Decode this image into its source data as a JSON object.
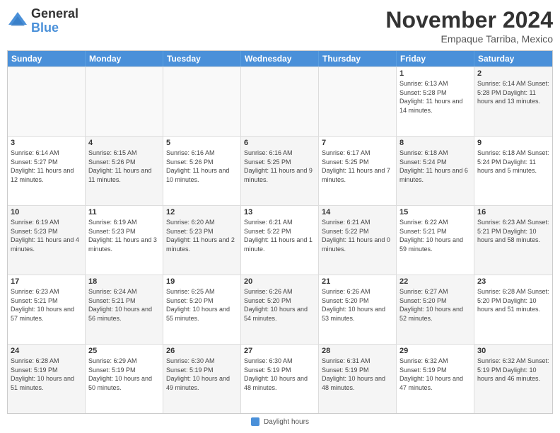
{
  "logo": {
    "general": "General",
    "blue": "Blue"
  },
  "title": "November 2024",
  "location": "Empaque Tarriba, Mexico",
  "headers": [
    "Sunday",
    "Monday",
    "Tuesday",
    "Wednesday",
    "Thursday",
    "Friday",
    "Saturday"
  ],
  "footer_label": "Daylight hours",
  "rows": [
    [
      {
        "day": "",
        "info": "",
        "empty": true
      },
      {
        "day": "",
        "info": "",
        "empty": true
      },
      {
        "day": "",
        "info": "",
        "empty": true
      },
      {
        "day": "",
        "info": "",
        "empty": true
      },
      {
        "day": "",
        "info": "",
        "empty": true
      },
      {
        "day": "1",
        "info": "Sunrise: 6:13 AM\nSunset: 5:28 PM\nDaylight: 11 hours\nand 14 minutes.",
        "empty": false
      },
      {
        "day": "2",
        "info": "Sunrise: 6:14 AM\nSunset: 5:28 PM\nDaylight: 11 hours\nand 13 minutes.",
        "empty": false,
        "shaded": true
      }
    ],
    [
      {
        "day": "3",
        "info": "Sunrise: 6:14 AM\nSunset: 5:27 PM\nDaylight: 11 hours\nand 12 minutes.",
        "empty": false
      },
      {
        "day": "4",
        "info": "Sunrise: 6:15 AM\nSunset: 5:26 PM\nDaylight: 11 hours\nand 11 minutes.",
        "empty": false,
        "shaded": true
      },
      {
        "day": "5",
        "info": "Sunrise: 6:16 AM\nSunset: 5:26 PM\nDaylight: 11 hours\nand 10 minutes.",
        "empty": false
      },
      {
        "day": "6",
        "info": "Sunrise: 6:16 AM\nSunset: 5:25 PM\nDaylight: 11 hours\nand 9 minutes.",
        "empty": false,
        "shaded": true
      },
      {
        "day": "7",
        "info": "Sunrise: 6:17 AM\nSunset: 5:25 PM\nDaylight: 11 hours\nand 7 minutes.",
        "empty": false
      },
      {
        "day": "8",
        "info": "Sunrise: 6:18 AM\nSunset: 5:24 PM\nDaylight: 11 hours\nand 6 minutes.",
        "empty": false,
        "shaded": true
      },
      {
        "day": "9",
        "info": "Sunrise: 6:18 AM\nSunset: 5:24 PM\nDaylight: 11 hours\nand 5 minutes.",
        "empty": false
      }
    ],
    [
      {
        "day": "10",
        "info": "Sunrise: 6:19 AM\nSunset: 5:23 PM\nDaylight: 11 hours\nand 4 minutes.",
        "empty": false,
        "shaded": true
      },
      {
        "day": "11",
        "info": "Sunrise: 6:19 AM\nSunset: 5:23 PM\nDaylight: 11 hours\nand 3 minutes.",
        "empty": false
      },
      {
        "day": "12",
        "info": "Sunrise: 6:20 AM\nSunset: 5:23 PM\nDaylight: 11 hours\nand 2 minutes.",
        "empty": false,
        "shaded": true
      },
      {
        "day": "13",
        "info": "Sunrise: 6:21 AM\nSunset: 5:22 PM\nDaylight: 11 hours\nand 1 minute.",
        "empty": false
      },
      {
        "day": "14",
        "info": "Sunrise: 6:21 AM\nSunset: 5:22 PM\nDaylight: 11 hours\nand 0 minutes.",
        "empty": false,
        "shaded": true
      },
      {
        "day": "15",
        "info": "Sunrise: 6:22 AM\nSunset: 5:21 PM\nDaylight: 10 hours\nand 59 minutes.",
        "empty": false
      },
      {
        "day": "16",
        "info": "Sunrise: 6:23 AM\nSunset: 5:21 PM\nDaylight: 10 hours\nand 58 minutes.",
        "empty": false,
        "shaded": true
      }
    ],
    [
      {
        "day": "17",
        "info": "Sunrise: 6:23 AM\nSunset: 5:21 PM\nDaylight: 10 hours\nand 57 minutes.",
        "empty": false
      },
      {
        "day": "18",
        "info": "Sunrise: 6:24 AM\nSunset: 5:21 PM\nDaylight: 10 hours\nand 56 minutes.",
        "empty": false,
        "shaded": true
      },
      {
        "day": "19",
        "info": "Sunrise: 6:25 AM\nSunset: 5:20 PM\nDaylight: 10 hours\nand 55 minutes.",
        "empty": false
      },
      {
        "day": "20",
        "info": "Sunrise: 6:26 AM\nSunset: 5:20 PM\nDaylight: 10 hours\nand 54 minutes.",
        "empty": false,
        "shaded": true
      },
      {
        "day": "21",
        "info": "Sunrise: 6:26 AM\nSunset: 5:20 PM\nDaylight: 10 hours\nand 53 minutes.",
        "empty": false
      },
      {
        "day": "22",
        "info": "Sunrise: 6:27 AM\nSunset: 5:20 PM\nDaylight: 10 hours\nand 52 minutes.",
        "empty": false,
        "shaded": true
      },
      {
        "day": "23",
        "info": "Sunrise: 6:28 AM\nSunset: 5:20 PM\nDaylight: 10 hours\nand 51 minutes.",
        "empty": false
      }
    ],
    [
      {
        "day": "24",
        "info": "Sunrise: 6:28 AM\nSunset: 5:19 PM\nDaylight: 10 hours\nand 51 minutes.",
        "empty": false,
        "shaded": true
      },
      {
        "day": "25",
        "info": "Sunrise: 6:29 AM\nSunset: 5:19 PM\nDaylight: 10 hours\nand 50 minutes.",
        "empty": false
      },
      {
        "day": "26",
        "info": "Sunrise: 6:30 AM\nSunset: 5:19 PM\nDaylight: 10 hours\nand 49 minutes.",
        "empty": false,
        "shaded": true
      },
      {
        "day": "27",
        "info": "Sunrise: 6:30 AM\nSunset: 5:19 PM\nDaylight: 10 hours\nand 48 minutes.",
        "empty": false
      },
      {
        "day": "28",
        "info": "Sunrise: 6:31 AM\nSunset: 5:19 PM\nDaylight: 10 hours\nand 48 minutes.",
        "empty": false,
        "shaded": true
      },
      {
        "day": "29",
        "info": "Sunrise: 6:32 AM\nSunset: 5:19 PM\nDaylight: 10 hours\nand 47 minutes.",
        "empty": false
      },
      {
        "day": "30",
        "info": "Sunrise: 6:32 AM\nSunset: 5:19 PM\nDaylight: 10 hours\nand 46 minutes.",
        "empty": false,
        "shaded": true
      }
    ]
  ]
}
